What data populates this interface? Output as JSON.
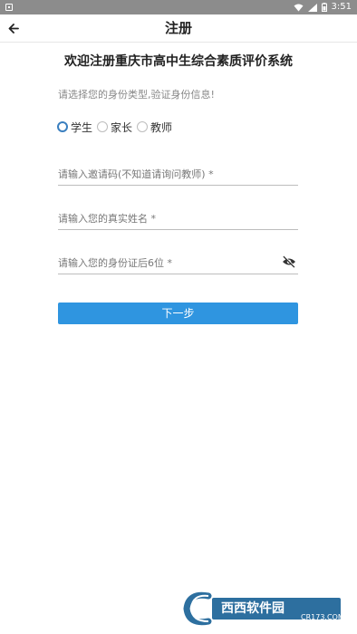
{
  "status_bar": {
    "time": "3:51"
  },
  "app_bar": {
    "title": "注册"
  },
  "main": {
    "heading": "欢迎注册重庆市高中生综合素质评价系统",
    "prompt": "请选择您的身份类型,验证身份信息!",
    "identity_options": [
      {
        "label": "学生",
        "checked": true
      },
      {
        "label": "家长",
        "checked": false
      },
      {
        "label": "教师",
        "checked": false
      }
    ],
    "fields": {
      "invite_code": {
        "placeholder": "请输入邀请码(不知道请询问教师) *",
        "value": ""
      },
      "real_name": {
        "placeholder": "请输入您的真实姓名 *",
        "value": ""
      },
      "id_last6": {
        "placeholder": "请输入您的身份证后6位 *",
        "value": ""
      }
    },
    "next_label": "下一步"
  },
  "watermark": {
    "brand": "西西软件园",
    "url": "CR173.COM"
  },
  "colors": {
    "primary": "#2f95e0",
    "radio_checked": "#3a7fbf",
    "statusbar": "#8c8c8c"
  }
}
